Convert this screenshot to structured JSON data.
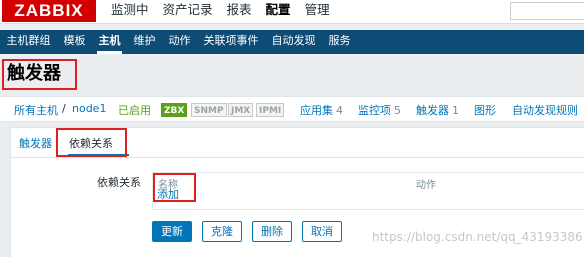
{
  "header": {
    "logo": "ZABBIX",
    "menu": [
      "监测中",
      "资产记录",
      "报表",
      "配置",
      "管理"
    ]
  },
  "subnav": [
    "主机群组",
    "模板",
    "主机",
    "维护",
    "动作",
    "关联项事件",
    "自动发现",
    "服务"
  ],
  "page": {
    "title": "触发器"
  },
  "breadcrumb": {
    "all_hosts": "所有主机",
    "separator": "/",
    "host": "node1",
    "status": "已启用",
    "badges": [
      "ZBX",
      "SNMP",
      "JMX",
      "IPMI"
    ],
    "links": [
      {
        "label": "应用集",
        "count": "4"
      },
      {
        "label": "监控项",
        "count": "5"
      },
      {
        "label": "触发器",
        "count": "1"
      },
      {
        "label": "图形",
        "count": ""
      },
      {
        "label": "自动发现规则",
        "count": ""
      }
    ]
  },
  "tabs": [
    "触发器",
    "依赖关系"
  ],
  "form": {
    "label": "依赖关系",
    "col_name": "名称",
    "col_action": "动作",
    "add_link": "添加"
  },
  "buttons": [
    "更新",
    "克隆",
    "删除",
    "取消"
  ],
  "watermark": "https://blog.csdn.net/qq_43193386",
  "colors": {
    "brand": "#d40000",
    "nav": "#0e4c75",
    "link": "#0275b8",
    "enabled": "#59a11a",
    "highlight": "#e02020"
  }
}
